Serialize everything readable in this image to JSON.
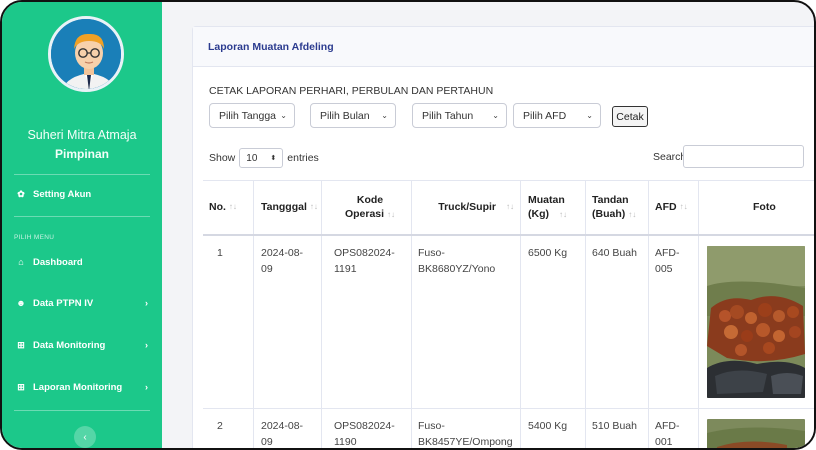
{
  "sidebar": {
    "user_name": "Suheri Mitra Atmaja",
    "user_role": "Pimpinan",
    "setting_label": "Setting Akun",
    "menu_heading": "PILIH MENU",
    "items": [
      {
        "label": "Dashboard",
        "icon": "home-icon",
        "chevron": ""
      },
      {
        "label": "Data PTPN IV",
        "icon": "users-icon",
        "chevron": "›"
      },
      {
        "label": "Data Monitoring",
        "icon": "sitemap-icon",
        "chevron": "›"
      },
      {
        "label": "Laporan Monitoring",
        "icon": "sitemap-icon",
        "chevron": "›"
      }
    ],
    "toggle": "‹"
  },
  "card": {
    "title": "Laporan Muatan Afdeling",
    "cetak_title": "CETAK LAPORAN PERHARI, PERBULAN DAN PERTAHUN",
    "filters": {
      "tanggal": "Pilih Tangga",
      "bulan": "Pilih Bulan",
      "tahun": "Pilih Tahun",
      "afd": "Pilih AFD"
    },
    "cetak_button": "Cetak"
  },
  "table_controls": {
    "show": "Show",
    "entries_value": "10",
    "entries": "entries",
    "search": "Search:"
  },
  "table": {
    "columns": [
      {
        "line1": "No.",
        "line2": ""
      },
      {
        "line1": "Tangggal",
        "line2": ""
      },
      {
        "line1": "Kode",
        "line2": "Operasi"
      },
      {
        "line1": "Truck/Supir",
        "line2": ""
      },
      {
        "line1": "Muatan",
        "line2": "(Kg)"
      },
      {
        "line1": "Tandan",
        "line2": "(Buah)"
      },
      {
        "line1": "AFD",
        "line2": ""
      },
      {
        "line1": "Foto",
        "line2": ""
      }
    ],
    "rows": [
      {
        "no": "1",
        "tanggal_1": "2024-08-",
        "tanggal_2": "09",
        "kode_1": "OPS082024-",
        "kode_2": "1191",
        "truck_1": "Fuso-",
        "truck_2": "BK8680YZ/Yono",
        "muatan": "6500 Kg",
        "tandan": "640 Buah",
        "afd_1": "AFD-",
        "afd_2": "005"
      },
      {
        "no": "2",
        "tanggal_1": "2024-08-",
        "tanggal_2": "09",
        "kode_1": "OPS082024-",
        "kode_2": "1190",
        "truck_1": "Fuso-",
        "truck_2": "BK8457YE/Ompong",
        "muatan": "5400 Kg",
        "tandan": "510 Buah",
        "afd_1": "AFD-",
        "afd_2": "001"
      }
    ]
  }
}
